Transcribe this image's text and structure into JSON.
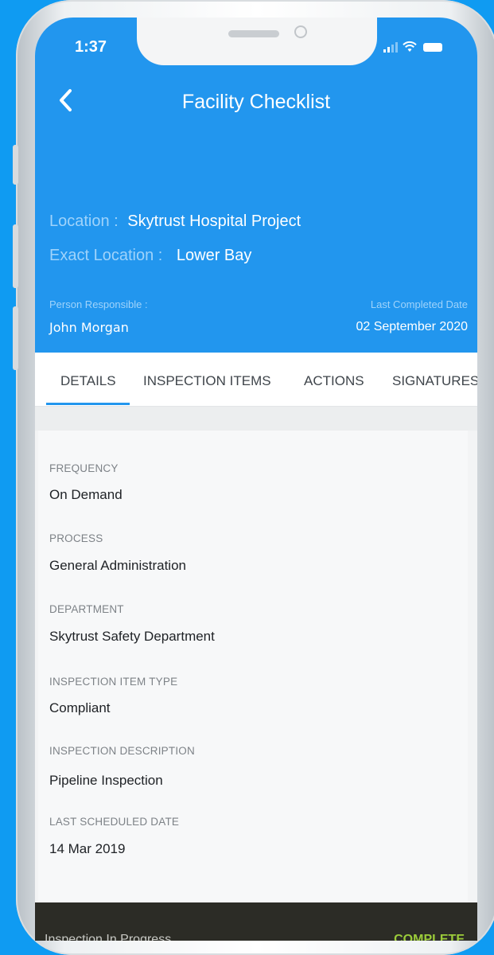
{
  "status_bar": {
    "time": "1:37"
  },
  "header": {
    "title": "Facility Checklist",
    "location_label": "Location :",
    "location_value": "Skytrust Hospital Project",
    "exact_location_label": "Exact Location :",
    "exact_location_value": "Lower Bay",
    "person_label": "Person Responsible :",
    "person_value": "John Morgan",
    "last_completed_label": "Last Completed Date",
    "last_completed_value": "02 September 2020"
  },
  "tabs": [
    {
      "label": "DETAILS",
      "active": true
    },
    {
      "label": "INSPECTION ITEMS",
      "active": false
    },
    {
      "label": "ACTIONS",
      "active": false
    },
    {
      "label": "SIGNATURES",
      "active": false
    }
  ],
  "fields": [
    {
      "label": "FREQUENCY",
      "value": "On Demand"
    },
    {
      "label": "PROCESS",
      "value": "General Administration"
    },
    {
      "label": "DEPARTMENT",
      "value": "Skytrust Safety Department"
    },
    {
      "label": "INSPECTION ITEM TYPE",
      "value": "Compliant"
    },
    {
      "label": "INSPECTION DESCRIPTION",
      "value": "Pipeline Inspection"
    },
    {
      "label": "LAST SCHEDULED DATE",
      "value": "14 Mar 2019"
    }
  ],
  "footer": {
    "left_text": "Inspection In Progress",
    "right_label": "COMPLETE"
  },
  "colors": {
    "background": "#0f9bf2",
    "header": "#2296ee",
    "accent": "#2296ee",
    "complete": "#9ccc3a"
  },
  "icons": [
    "back-chevron-icon",
    "signal-icon",
    "wifi-icon",
    "battery-icon"
  ]
}
